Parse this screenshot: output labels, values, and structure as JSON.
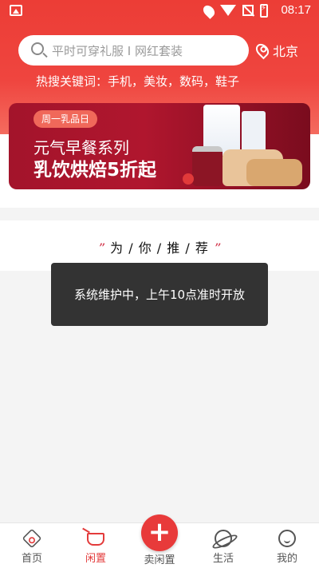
{
  "status_bar": {
    "time": "08:17"
  },
  "search": {
    "placeholder": "平时可穿礼服 I 网红套装"
  },
  "city": {
    "name": "北京"
  },
  "hot_keywords": {
    "text": "热搜关键词：手机，美妆，数码，鞋子"
  },
  "banner": {
    "tag": "周一乳品日",
    "line1": "元气早餐系列",
    "line2": "乳饮烘焙5折起"
  },
  "recommend": {
    "title": "为 / 你 / 推 / 荐",
    "quote_open": "”",
    "quote_close": "”"
  },
  "toast": {
    "message": "系统维护中，上午10点准时开放"
  },
  "tabbar": {
    "home": "首页",
    "idle": "闲置",
    "sell": "卖闲置",
    "life": "生活",
    "mine": "我的",
    "sell_symbol": "+"
  },
  "colors": {
    "brand_red": "#ec3d36",
    "active_tab": "#e33b3b",
    "toast_bg": "#333333"
  },
  "icons": [
    "image-icon",
    "location-icon",
    "wifi-icon",
    "no-signal-icon",
    "battery-icon",
    "search-icon",
    "location-pin-icon",
    "home-icon",
    "cart-icon",
    "plus-icon",
    "planet-icon",
    "profile-icon"
  ]
}
